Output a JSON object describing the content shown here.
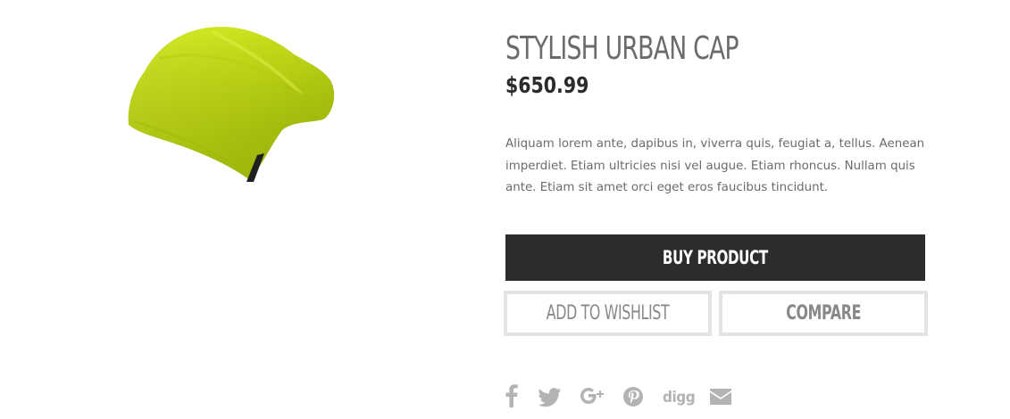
{
  "product": {
    "title": "STYLISH URBAN CAP",
    "price": "$650.99",
    "description": "Aliquam lorem ante, dapibus in, viverra quis, feugiat a, tellus. Aenean imperdiet. Etiam ultricies nisi vel augue. Etiam rhoncus. Nullam quis ante. Etiam sit amet orci eget eros faucibus tincidunt.",
    "image_icon": "beanie-cap-image"
  },
  "actions": {
    "buy_label": "BUY PRODUCT",
    "wishlist_label": "ADD TO WISHLIST",
    "compare_label": "COMPARE"
  },
  "social": {
    "icons": [
      "facebook-icon",
      "twitter-icon",
      "google-plus-icon",
      "pinterest-icon",
      "digg-icon",
      "email-icon"
    ],
    "digg_text": "digg"
  },
  "colors": {
    "accent_dark": "#2c2c2c",
    "button_border": "#e4e4e4",
    "text_gray": "#6b6b6b",
    "icon_gray": "#b3b3b3",
    "cap_yellow": "#c9e21a"
  }
}
